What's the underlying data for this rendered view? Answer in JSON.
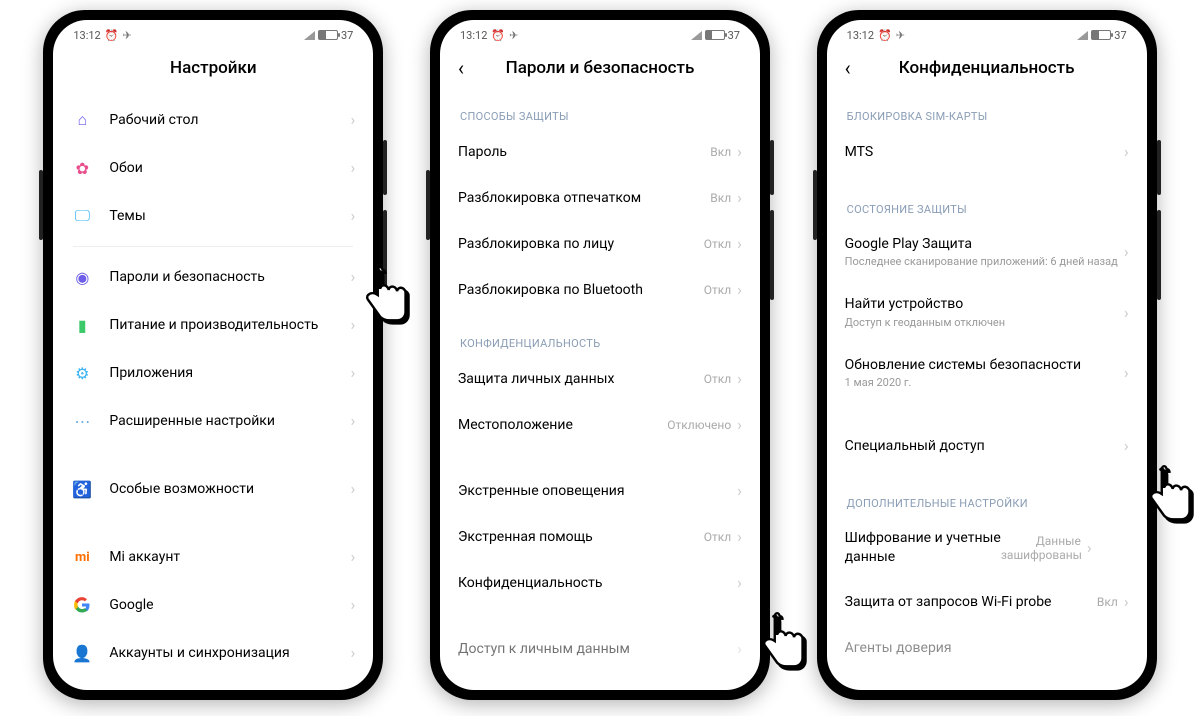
{
  "status": {
    "time": "13:12",
    "battery_percent": "37"
  },
  "phone1": {
    "title": "Настройки",
    "items": [
      {
        "label": "Рабочий стол"
      },
      {
        "label": "Обои"
      },
      {
        "label": "Темы"
      },
      {
        "label": "Пароли и безопасность"
      },
      {
        "label": "Питание и производительность"
      },
      {
        "label": "Приложения"
      },
      {
        "label": "Расширенные настройки"
      },
      {
        "label": "Особые возможности"
      },
      {
        "label": "Mi аккаунт"
      },
      {
        "label": "Google"
      },
      {
        "label": "Аккаунты и синхронизация"
      }
    ]
  },
  "phone2": {
    "title": "Пароли и безопасность",
    "section1": "СПОСОБЫ ЗАЩИТЫ",
    "section2": "КОНФИДЕНЦИАЛЬНОСТЬ",
    "items": [
      {
        "label": "Пароль",
        "value": "Вкл"
      },
      {
        "label": "Разблокировка отпечатком",
        "value": "Вкл"
      },
      {
        "label": "Разблокировка по лицу",
        "value": "Откл"
      },
      {
        "label": "Разблокировка по Bluetooth",
        "value": "Откл"
      },
      {
        "label": "Защита личных данных",
        "value": "Откл"
      },
      {
        "label": "Местоположение",
        "value": "Отключено"
      },
      {
        "label": "Экстренные оповещения",
        "value": ""
      },
      {
        "label": "Экстренная помощь",
        "value": "Откл"
      },
      {
        "label": "Конфиденциальность",
        "value": ""
      },
      {
        "label": "Доступ к личным данным",
        "value": ""
      }
    ]
  },
  "phone3": {
    "title": "Конфиденциальность",
    "section1": "БЛОКИРОВКА SIM-КАРТЫ",
    "section2": "СОСТОЯНИЕ ЗАЩИТЫ",
    "section3": "ДОПОЛНИТЕЛЬНЫЕ НАСТРОЙКИ",
    "items": [
      {
        "label": "MTS",
        "sub": "",
        "value": ""
      },
      {
        "label": "Google Play Защита",
        "sub": "Последнее сканирование приложений: 6 дней назад",
        "value": ""
      },
      {
        "label": "Найти устройство",
        "sub": "Доступ к геоданным отключен",
        "value": ""
      },
      {
        "label": "Обновление системы безопасности",
        "sub": "1 мая 2020 г.",
        "value": ""
      },
      {
        "label": "Специальный доступ",
        "sub": "",
        "value": ""
      },
      {
        "label": "Шифрование и учетные данные",
        "sub": "",
        "value": "Данные зашифрованы"
      },
      {
        "label": "Защита от запросов Wi-Fi probe",
        "sub": "",
        "value": "Вкл"
      },
      {
        "label": "Агенты доверия",
        "sub": "",
        "value": ""
      }
    ]
  }
}
